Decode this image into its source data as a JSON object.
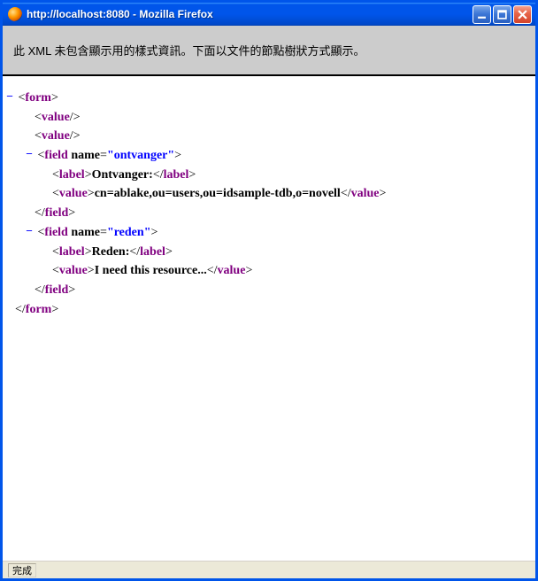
{
  "window": {
    "title": "http://localhost:8080 - Mozilla Firefox"
  },
  "banner": {
    "message": "此 XML 未包含顯示用的樣式資訊。下面以文件的節點樹狀方式顯示。"
  },
  "xml": {
    "root_open": "form",
    "value_empty1": "value",
    "value_empty2": "value",
    "field1": {
      "tag": "field",
      "attr_name": "name",
      "attr_value": "ontvanger",
      "label_tag": "label",
      "label_text": "Ontvanger:",
      "value_tag": "value",
      "value_text": "cn=ablake,ou=users,ou=idsample-tdb,o=novell",
      "close": "field"
    },
    "field2": {
      "tag": "field",
      "attr_name": "name",
      "attr_value": "reden",
      "label_tag": "label",
      "label_text": "Reden:",
      "value_tag": "value",
      "value_text": "I need this resource...",
      "close": "field"
    },
    "root_close": "form"
  },
  "statusbar": {
    "text": "完成"
  },
  "glyphs": {
    "minus": "−"
  }
}
